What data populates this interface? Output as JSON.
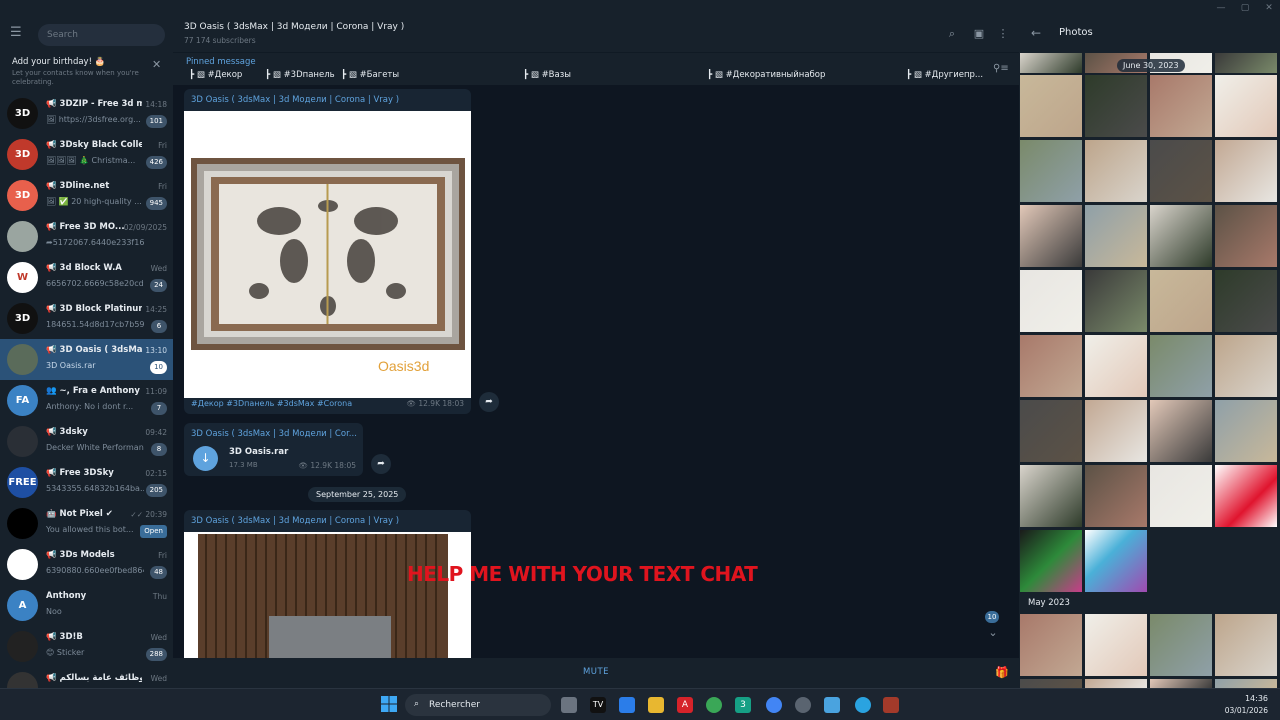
{
  "sidebar": {
    "search_placeholder": "Search",
    "birthday_title": "Add your birthday! 🎂",
    "birthday_sub": "Let your contacts know when you're celebrating.",
    "chats": [
      {
        "avatar": "3D",
        "avatar_color": "#111111",
        "name": "📢 3DZIP - Free 3d mo...",
        "time": "14:18",
        "msg": "🖼 https://3dsfree.org...",
        "badge": "101"
      },
      {
        "avatar": "3D",
        "avatar_color": "#c0392b",
        "name": "📢 3Dsky Black Collectio...",
        "time": "Fri",
        "msg": "🖼🖼🖼 🎄 Christma...",
        "badge": "426"
      },
      {
        "avatar": "3D",
        "avatar_color": "#e8604c",
        "name": "📢 3Dline.net",
        "time": "Fri",
        "msg": "🖼 ✅ 20 high-quality ...",
        "badge": "945"
      },
      {
        "avatar": "",
        "avatar_color": "#9aa5a0",
        "name": "📢 Free 3D MO...",
        "time": "02/09/2025",
        "msg": "➦5172067.6440e233f16...",
        "badge": ""
      },
      {
        "avatar": "W",
        "avatar_color": "#ffffff",
        "name": "📢 3d Block W.A",
        "time": "Wed",
        "msg": "6656702.6669c58e20cd0...",
        "badge": "24"
      },
      {
        "avatar": "3D",
        "avatar_color": "#111111",
        "name": "📢 3D Block Platinum...",
        "time": "14:25",
        "msg": "184651.54d8d17cb7b59...",
        "badge": "6"
      },
      {
        "avatar": "",
        "avatar_color": "#5a6b5a",
        "name": "📢 3D Oasis ( 3dsMax ...",
        "time": "13:10",
        "msg": "3D Oasis.rar",
        "badge": "10"
      },
      {
        "avatar": "FA",
        "avatar_color": "#3b82c4",
        "name": "👥 ~, Fra e Anthony",
        "time": "11:09",
        "msg": "Anthony: No i dont r...",
        "badge": "7"
      },
      {
        "avatar": "",
        "avatar_color": "#2a2f36",
        "name": "📢 3dsky",
        "time": "09:42",
        "msg": "Decker White Performan...",
        "badge": "8"
      },
      {
        "avatar": "FREE",
        "avatar_color": "#1e4fa3",
        "name": "📢 Free 3DSky",
        "time": "02:15",
        "msg": "5343355.64832b164ba...",
        "badge": "205"
      },
      {
        "avatar": "",
        "avatar_color": "#000000",
        "name": "🤖 Not Pixel ✔",
        "time": "✓✓ 20:39",
        "msg": "You allowed this bot...",
        "badge": "Open"
      },
      {
        "avatar": "",
        "avatar_color": "#ffffff",
        "name": "📢 3Ds Models",
        "time": "Fri",
        "msg": "6390880.660ee0fbed864...",
        "badge": "48"
      },
      {
        "avatar": "A",
        "avatar_color": "#3b82c4",
        "name": "Anthony",
        "time": "Thu",
        "msg": "Noo",
        "badge": ""
      },
      {
        "avatar": "",
        "avatar_color": "#222222",
        "name": "📢 3D!B",
        "time": "Wed",
        "msg": "😊 Sticker",
        "badge": "288"
      },
      {
        "avatar": "",
        "avatar_color": "#333333",
        "name": "📢 وظائف عامة بسالكم ...",
        "time": "Wed",
        "msg": "",
        "badge": ""
      }
    ]
  },
  "header": {
    "title": "3D Oasis ( 3dsMax | 3d Модели | Corona | Vray )",
    "subscribers": "77 174 subscribers"
  },
  "pinned": {
    "label": "Pinned message",
    "tags": [
      "#Декор",
      "#3Dпанель",
      "#Багеты",
      "#Вазы",
      "#Декоративныйнабор",
      "#Другиепр..."
    ]
  },
  "messages": {
    "post1_author": "3D Oasis ( 3dsMax | 3d Модели | Corona | Vray )",
    "post1_watermark": "Oasis3d",
    "post1_tags": "#Декор #3Dпанель #3dsMax #Corona",
    "post1_views": "👁 12.9K  18:03",
    "file_author": "3D Oasis ( 3dsMax | 3d Модели | Cor...",
    "file_name": "3D Oasis.rar",
    "file_size": "17.3 MB",
    "file_views": "👁 12.9K  18:05",
    "date": "September 25, 2025",
    "post2_author": "3D Oasis ( 3dsMax | 3d Модели | Corona | Vray )",
    "overlay": "HELP ME WITH YOUR TEXT CHAT",
    "unread_count": "10"
  },
  "bottom": {
    "mute": "MUTE"
  },
  "photos": {
    "title": "Photos",
    "month_pill": "June 30, 2023",
    "month_label": "May 2023"
  },
  "taskbar": {
    "search": "Rechercher",
    "time": "14:36",
    "date": "03/01/2026"
  }
}
